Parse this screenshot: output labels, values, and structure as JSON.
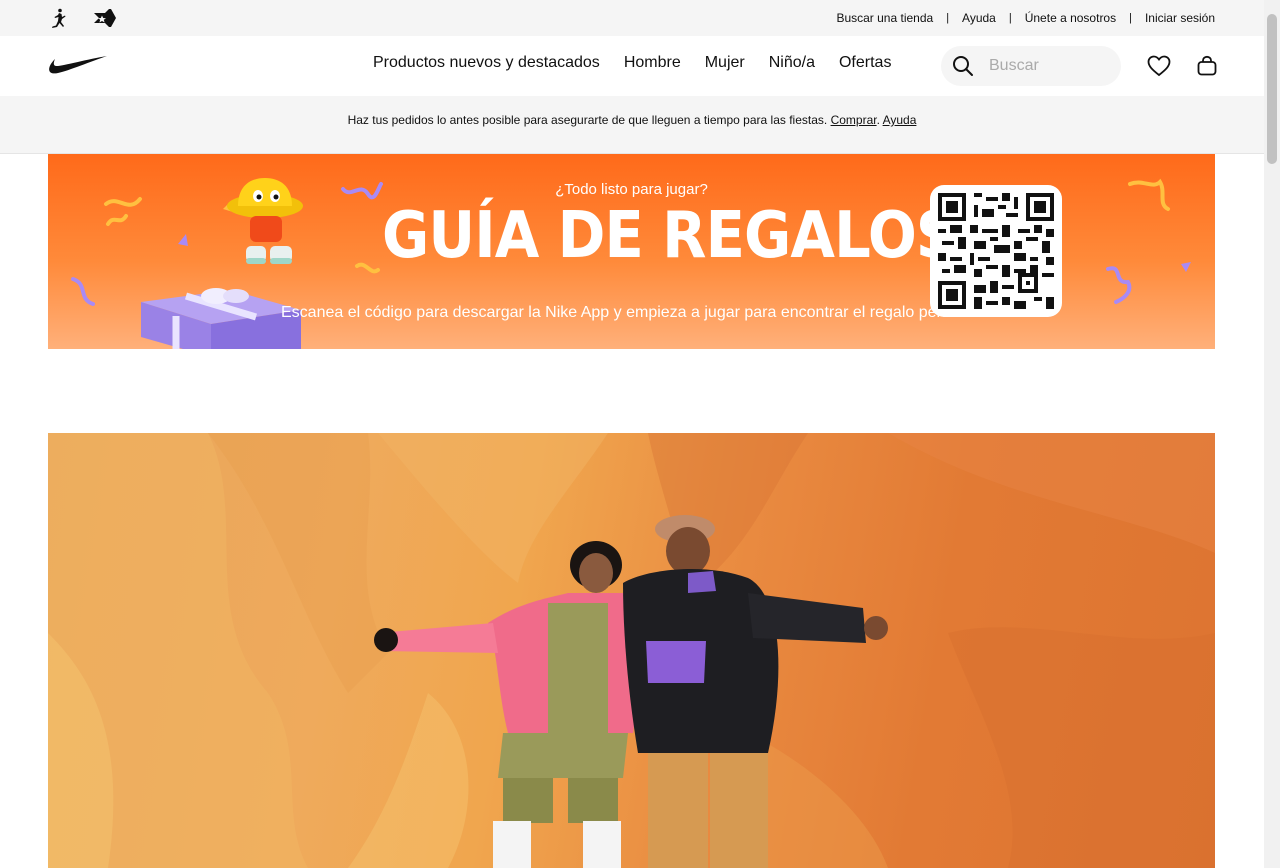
{
  "utility": {
    "brands": [
      "jordan-icon",
      "converse-icon"
    ],
    "links": [
      "Buscar una tienda",
      "Ayuda",
      "Únete a nosotros",
      "Iniciar sesión"
    ],
    "separator": "|"
  },
  "nav": {
    "items": [
      "Productos nuevos y destacados",
      "Hombre",
      "Mujer",
      "Niño/a",
      "Ofertas"
    ],
    "search_placeholder": "Buscar"
  },
  "promo": {
    "text": "Haz tus pedidos lo antes posible para asegurarte de que lleguen a tiempo para las fiestas.",
    "link_shop": "Comprar",
    "link_help": "Ayuda"
  },
  "banner": {
    "pre_title": "¿Todo listo para jugar?",
    "title": "GUÍA DE REGALOS",
    "subtitle": "Escanea el código para descargar la Nike App y empieza a jugar para encontrar el regalo perfecto."
  },
  "colors": {
    "banner_orange": "#ff6a1a",
    "hero_orange": "#e98a40"
  }
}
